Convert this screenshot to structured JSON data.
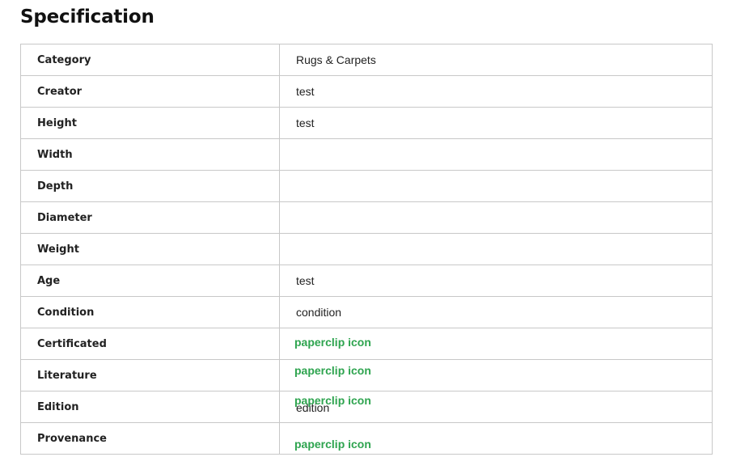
{
  "heading": "Specification",
  "rows": [
    {
      "label": "Category",
      "value": "Rugs & Carpets"
    },
    {
      "label": "Creator",
      "value": "test"
    },
    {
      "label": "Height",
      "value": "test"
    },
    {
      "label": "Width",
      "value": ""
    },
    {
      "label": "Depth",
      "value": ""
    },
    {
      "label": "Diameter",
      "value": ""
    },
    {
      "label": "Weight",
      "value": ""
    },
    {
      "label": "Age",
      "value": "test"
    },
    {
      "label": "Condition",
      "value": "condition"
    },
    {
      "label": "Certificated",
      "attachment": "paperclip icon"
    },
    {
      "label": "Literature",
      "attachment": "paperclip icon"
    },
    {
      "label": "Edition",
      "value": "edition",
      "attachment": "paperclip icon"
    },
    {
      "label": "Provenance",
      "attachment": "paperclip icon"
    }
  ],
  "colors": {
    "attachment_text": "#2ea44f",
    "border": "#c8c8c8"
  }
}
